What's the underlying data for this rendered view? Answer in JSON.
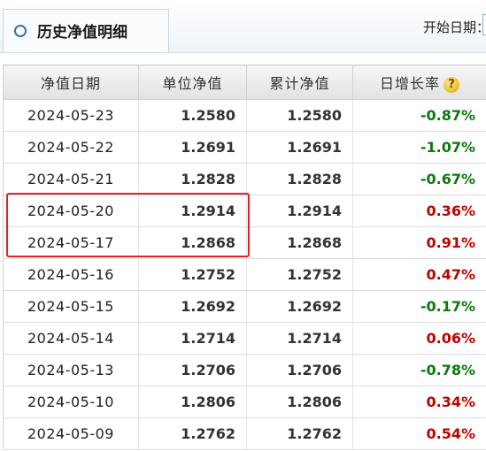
{
  "panel": {
    "title": "历史净值明细",
    "start_date_label": "开始日期：",
    "start_date_value": ""
  },
  "table": {
    "headers": [
      "净值日期",
      "单位净值",
      "累计净值",
      "日增长率"
    ],
    "rows": [
      {
        "date": "2024-05-23",
        "unit": "1.2580",
        "acc": "1.2580",
        "growth": "-0.87%"
      },
      {
        "date": "2024-05-22",
        "unit": "1.2691",
        "acc": "1.2691",
        "growth": "-1.07%"
      },
      {
        "date": "2024-05-21",
        "unit": "1.2828",
        "acc": "1.2828",
        "growth": "-0.67%"
      },
      {
        "date": "2024-05-20",
        "unit": "1.2914",
        "acc": "1.2914",
        "growth": "0.36%"
      },
      {
        "date": "2024-05-17",
        "unit": "1.2868",
        "acc": "1.2868",
        "growth": "0.91%"
      },
      {
        "date": "2024-05-16",
        "unit": "1.2752",
        "acc": "1.2752",
        "growth": "0.47%"
      },
      {
        "date": "2024-05-15",
        "unit": "1.2692",
        "acc": "1.2692",
        "growth": "-0.17%"
      },
      {
        "date": "2024-05-14",
        "unit": "1.2714",
        "acc": "1.2714",
        "growth": "0.06%"
      },
      {
        "date": "2024-05-13",
        "unit": "1.2706",
        "acc": "1.2706",
        "growth": "-0.78%"
      },
      {
        "date": "2024-05-10",
        "unit": "1.2806",
        "acc": "1.2806",
        "growth": "0.34%"
      },
      {
        "date": "2024-05-09",
        "unit": "1.2762",
        "acc": "1.2762",
        "growth": "0.54%"
      }
    ]
  },
  "help_icon": {
    "name": "help-icon",
    "glyph": "?"
  },
  "colors": {
    "up": "#c00000",
    "down": "#0a7a0a",
    "highlight": "#e0232a"
  }
}
